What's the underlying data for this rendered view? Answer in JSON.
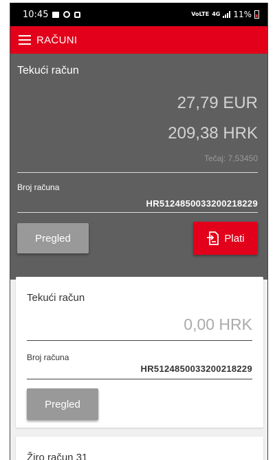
{
  "status_bar": {
    "time": "10:45",
    "network": "VoLTE",
    "signal": "4G",
    "battery": "11%"
  },
  "app_bar": {
    "title": "RAČUNI",
    "menu_icon": "hamburger-menu-icon"
  },
  "main_account": {
    "title": "Tekući račun",
    "balance_eur": "27,79 EUR",
    "balance_hrk": "209,38 HRK",
    "exchange_rate": "Tečaj: 7,53450",
    "account_number_label": "Broj računa",
    "account_number": "HR5124850033200218229",
    "review_button": "Pregled",
    "pay_button": "Plati",
    "pay_icon": "payment-document-icon"
  },
  "accounts": [
    {
      "title": "Tekući račun",
      "balance": "0,00 HRK",
      "account_number_label": "Broj računa",
      "account_number": "HR5124850033200218229",
      "review_button": "Pregled"
    },
    {
      "title": "Žiro račun 31"
    }
  ],
  "colors": {
    "brand_red": "#e2001a",
    "dark_panel": "#5f5f5f",
    "button_gray": "#999999"
  }
}
